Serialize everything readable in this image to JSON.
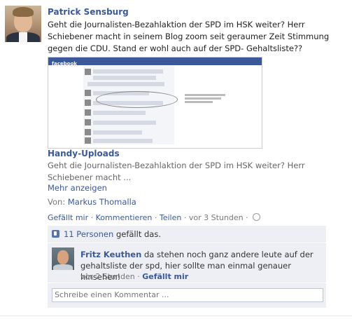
{
  "post": {
    "author": "Patrick Sensburg",
    "text": "Geht die Journalisten-Bezahlaktion der SPD im HSK weiter? Herr Schiebener macht in seinem Blog zoom seit geraumer Zeit Stimmung gegen die CDU. Stand er wohl auch auf der SPD- Gehaltsliste??"
  },
  "attachment": {
    "thumb_brand": "facebook",
    "album_title": "Handy-Uploads",
    "description": "Geht die Journalisten-Bezahlaktion der SPD im HSK weiter? Herr Schiebener macht ...",
    "more_label": "Mehr anzeigen",
    "from_label": "Von:",
    "from_name": "Markus Thomalla"
  },
  "actions": {
    "like": "Gefällt mir",
    "sep1": "·",
    "comment": "Kommentieren",
    "sep2": "·",
    "share": "Teilen",
    "sep3": "·",
    "time": "vor 3 Stunden",
    "sep4": "·"
  },
  "likes": {
    "people_link": "11 Personen",
    "suffix": "gefällt das."
  },
  "comments": [
    {
      "name": "Fritz Keuthen",
      "text": "da stehen noch ganz andere leute auf der gehaltsliste der spd, hier sollte man einmal genauer hinsehen!",
      "time": "vor 2 Stunden",
      "sep": "·",
      "like": "Gefällt mir"
    }
  ],
  "comment_input": {
    "placeholder": "Schreibe einen Kommentar ..."
  },
  "icons": {
    "like": "thumbs-up-icon",
    "privacy": "globe-icon"
  },
  "colors": {
    "link": "#3b5998",
    "feedback_bg": "#edeff4"
  }
}
